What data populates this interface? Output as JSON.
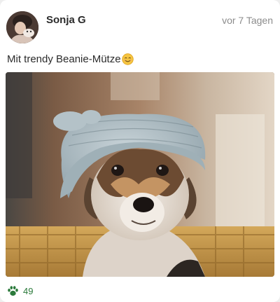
{
  "post": {
    "author": "Sonja G",
    "time": "vor 7 Tagen",
    "text": "Mit trendy Beanie-Mütze",
    "text_emoji_icon": "smiling-face-emoji-icon",
    "photo_subject": "dog wearing a knitted grey-blue beanie hat",
    "likes": "49",
    "like_icon": "paw-icon"
  },
  "colors": {
    "card_bg": "#ffffff",
    "author_text": "#2b2b2b",
    "time_text": "#8c8c8c",
    "like_accent": "#2b7a3b",
    "emoji_yellow": "#f5c542"
  }
}
